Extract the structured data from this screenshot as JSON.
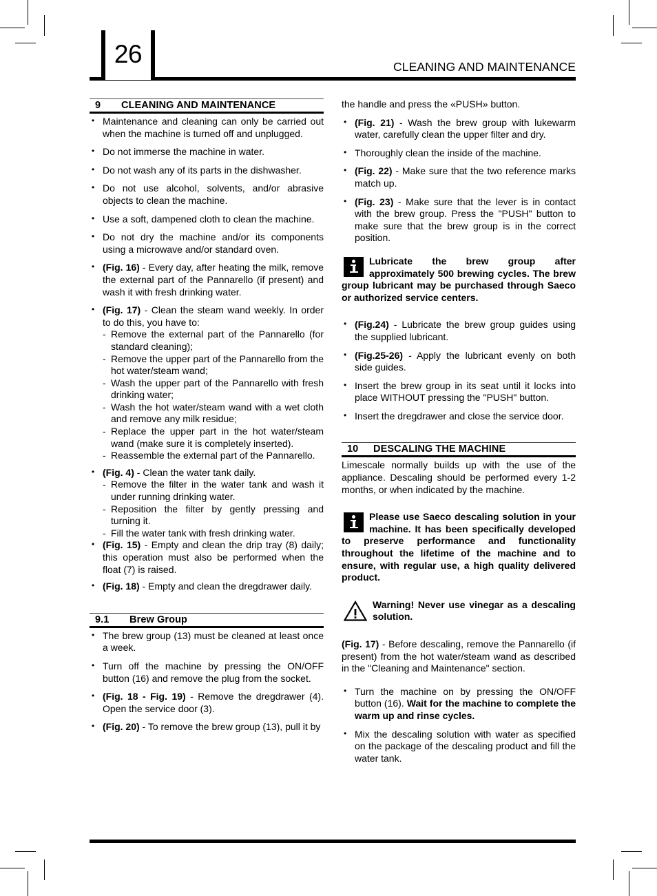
{
  "page": {
    "number": "26",
    "header_title": "CLEANING AND MAINTENANCE"
  },
  "icons": {
    "info": "info-icon",
    "warning": "warning-triangle-icon"
  },
  "sections": {
    "cleaning": {
      "number": "9",
      "title": "CLEANING AND MAINTENANCE"
    },
    "brew_group": {
      "number": "9.1",
      "title": "Brew Group"
    },
    "descaling": {
      "number": "10",
      "title": "DESCALING THE MACHINE"
    }
  },
  "left_column": {
    "bullets": [
      "Maintenance and cleaning can only be carried out when the machine is turned off and unplugged.",
      "Do not immerse the machine in water.",
      "Do not wash any of its parts in the dishwasher.",
      "Do not use alcohol, solvents, and/or abrasive objects to clean the machine.",
      "Use a soft, dampened cloth to clean the machine.",
      "Do not dry the machine and/or its components using a microwave and/or standard oven."
    ],
    "fig16": {
      "label": "(Fig. 16)",
      "text": " - Every day, after heating the milk, remove the external part of the Pannarello (if present) and wash it with fresh drinking water."
    },
    "fig17": {
      "label": "(Fig. 17)",
      "text": " - Clean the steam wand weekly. In order to do this, you have to:",
      "subitems": [
        "Remove the external part of the Pannarello (for standard cleaning);",
        "Remove the upper part of the Pannarello from the hot water/steam wand;",
        "Wash the upper part of the Pannarello with fresh drinking water;",
        "Wash the hot water/steam wand with a wet cloth and remove any milk residue;",
        "Replace the upper part in the hot water/steam wand (make sure it is completely inserted).",
        "Reassemble the external part of the Pannarello."
      ]
    },
    "fig4": {
      "label": "(Fig. 4)",
      "text": " - Clean the water tank daily.",
      "subitems": [
        "Remove the filter in the water tank and wash it under running drinking water.",
        "Reposition the filter by gently pressing and turning it.",
        "Fill the water tank with fresh drinking water."
      ]
    },
    "fig15": {
      "label": "(Fig. 15)",
      "text": " - Empty and clean the drip tray (8) daily; this operation must also be performed when the float (7) is raised."
    },
    "fig18": {
      "label": "(Fig. 18)",
      "text": " - Empty and clean the dregdrawer daily."
    },
    "brew_group_items": [
      {
        "label": "",
        "text": "The brew group (13) must be cleaned at least once a week."
      },
      {
        "label": "",
        "text": "Turn off the machine by pressing the ON/OFF button (16) and remove the plug from the socket."
      },
      {
        "label": "(Fig. 18 - Fig. 19)",
        "text": " - Remove the dregdrawer (4). Open the service door (3)."
      },
      {
        "label": "(Fig. 20)",
        "text": " - To remove the brew group (13), pull it by"
      }
    ]
  },
  "right_column": {
    "continuation": "the handle and press the «PUSH» button.",
    "bullets": [
      {
        "label": "(Fig. 21)",
        "text": " - Wash the brew group with lukewarm water, carefully clean the upper filter and dry."
      },
      {
        "label": "",
        "text": "Thoroughly clean the inside of the machine."
      },
      {
        "label": "(Fig. 22)",
        "text": " - Make sure that the two reference marks match up."
      },
      {
        "label": "(Fig. 23)",
        "text": " - Make sure that the lever is in contact with the brew group. Press the \"PUSH\" button to make sure that the brew group is in the correct position."
      }
    ],
    "notice_lubricate": "Lubricate the brew group after approximately 500 brewing cycles. The brew group lubricant may be purchased through Saeco or authorized service centers.",
    "bullets2": [
      {
        "label": "(Fig.24)",
        "text": " - Lubricate the brew group guides using the supplied lubricant."
      },
      {
        "label": "(Fig.25-26)",
        "text": " - Apply the lubricant evenly on both side guides."
      },
      {
        "label": "",
        "text": "Insert the brew group in its seat until it locks into place WITHOUT pressing the \"PUSH\" button."
      },
      {
        "label": "",
        "text": "Insert the dregdrawer and close the service door."
      }
    ],
    "descaling_intro": "Limescale normally builds up with the use of the appliance. Descaling should be performed every 1-2 months, or when indicated by the machine.",
    "notice_saeco": "Please use Saeco descaling solution in your machine. It has been specifically developed to preserve performance and functionality throughout the lifetime of the machine and to ensure, with regular use, a high quality delivered product.",
    "notice_warning": "Warning! Never use vinegar as a descaling solution.",
    "fig17": {
      "label": "(Fig. 17)",
      "text": " - Before descaling, remove the Pannarello (if present) from the hot water/steam wand as described in the \"Cleaning and Maintenance\" section."
    },
    "bullets3": [
      {
        "pre": "Turn the machine on by pressing the ON/OFF button (16). ",
        "bold": "Wait for the machine to complete the warm up and rinse cycles.",
        "post": ""
      },
      {
        "pre": "Mix the descaling solution with water as specified on the package of the descaling product and fill the water tank.",
        "bold": "",
        "post": ""
      }
    ]
  }
}
